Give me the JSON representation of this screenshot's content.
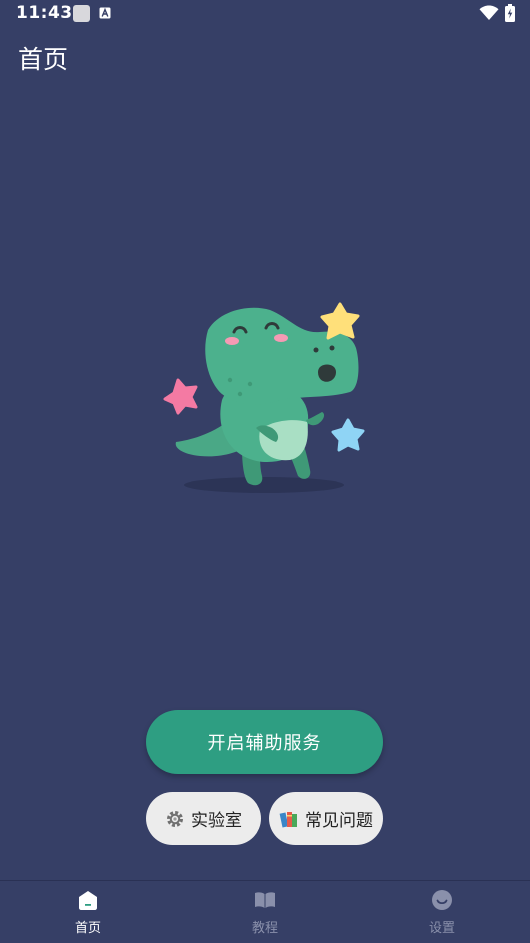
{
  "status_bar": {
    "time": "11:43",
    "notification_icons": [
      "square-icon",
      "a-badge-icon"
    ],
    "system_icons": [
      "wifi-icon",
      "battery-charging-icon"
    ]
  },
  "header": {
    "title": "首页"
  },
  "main": {
    "illustration": "dinosaur-mascot-illustration",
    "primary_button_label": "开启辅助服务",
    "chips": [
      {
        "label": "实验室",
        "icon": "gear-icon"
      },
      {
        "label": "常见问题",
        "icon": "books-icon"
      }
    ]
  },
  "bottom_nav": {
    "items": [
      {
        "label": "首页",
        "icon": "home-icon",
        "active": true
      },
      {
        "label": "教程",
        "icon": "book-icon",
        "active": false
      },
      {
        "label": "设置",
        "icon": "smiley-icon",
        "active": false
      }
    ]
  },
  "colors": {
    "background": "#363f66",
    "primary": "#2e9e82",
    "chip_background": "#ececec",
    "nav_inactive": "#8a90ab"
  }
}
